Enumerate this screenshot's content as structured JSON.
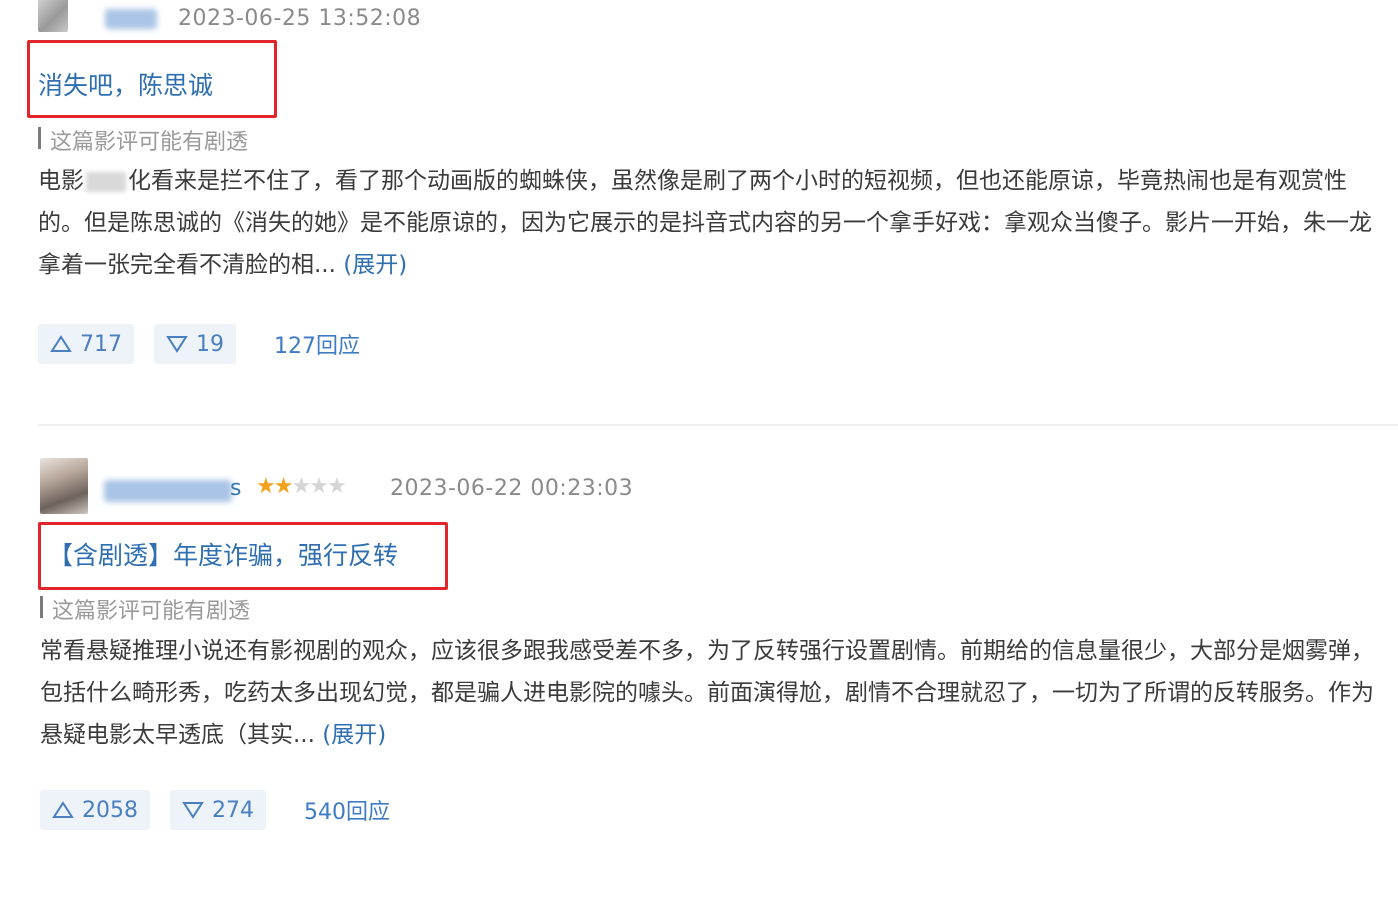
{
  "reviews": [
    {
      "timestamp": "2023-06-25 13:52:08",
      "title": "消失吧，陈思诚",
      "spoiler_note": "这篇影评可能有剧透",
      "body_before_blur": "电影",
      "body_after_blur": "化看来是拦不住了，看了那个动画版的蜘蛛侠，虽然像是刷了两个小时的短视频，但也还能原谅，毕竟热闹也是有观赏性的。但是陈思诚的《消失的她》是不能原谅的，因为它展示的是抖音式内容的另一个拿手好戏：拿观众当傻子。影片一开始，朱一龙拿着一张完全看不清脸的相... ",
      "expand_label": "(展开)",
      "upvotes": "717",
      "downvotes": "19",
      "replies": "127回应"
    },
    {
      "username_tail": "s",
      "rating": 2,
      "max_rating": 5,
      "timestamp": "2023-06-22 00:23:03",
      "title": "【含剧透】年度诈骗，强行反转",
      "spoiler_note": "这篇影评可能有剧透",
      "body": "常看悬疑推理小说还有影视剧的观众，应该很多跟我感受差不多，为了反转强行设置剧情。前期给的信息量很少，大部分是烟雾弹，包括什么畸形秀，吃药太多出现幻觉，都是骗人进电影院的噱头。前面演得尬，剧情不合理就忍了，一切为了所谓的反转服务。作为悬疑电影太早透底（其实... ",
      "expand_label": "(展开)",
      "upvotes": "2058",
      "downvotes": "274",
      "replies": "540回应"
    }
  ],
  "colors": {
    "link": "#2f6fb1",
    "highlight_box": "#e0262c",
    "star": "#f4a21c",
    "vote_bg": "#eef3f9"
  }
}
